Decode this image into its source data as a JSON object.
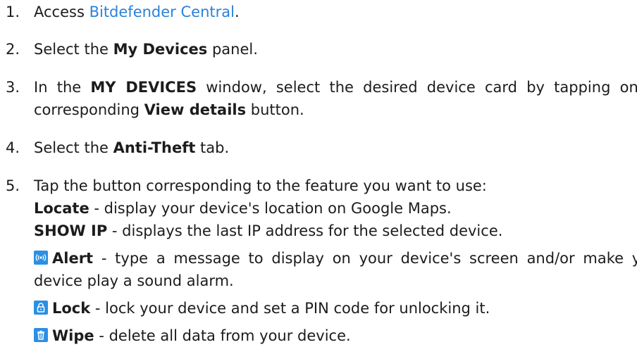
{
  "steps": [
    {
      "num": "1.",
      "text_before": "Access ",
      "link": "Bitdefender Central",
      "text_after": "."
    },
    {
      "num": "2.",
      "text_before": "Select the ",
      "bold": "My Devices",
      "text_after": " panel."
    },
    {
      "num": "3.",
      "text_before": "In the ",
      "bold1": "MY DEVICES",
      "text_mid": " window, select the desired device card by tapping on its corresponding ",
      "bold2": "View details",
      "text_after": " button."
    },
    {
      "num": "4.",
      "text_before": "Select the ",
      "bold": "Anti-Theft",
      "text_after": " tab."
    },
    {
      "num": "5.",
      "text": "Tap the button corresponding to the feature you want to use:"
    }
  ],
  "features": [
    {
      "name": "Locate",
      "desc": " - display your device's location on Google Maps."
    },
    {
      "name": "SHOW IP",
      "desc": " - displays the last IP address for the selected device."
    },
    {
      "icon": "alert-icon",
      "name": "Alert",
      "desc": " - type a message to display on your device's screen and/or make your device play a sound alarm."
    },
    {
      "icon": "lock-icon",
      "name": "Lock",
      "desc": " - lock your device and set a PIN code for unlocking it."
    },
    {
      "icon": "wipe-icon",
      "name": "Wipe",
      "desc": " - delete all data from your device."
    }
  ],
  "colors": {
    "link": "#2a82db",
    "icon_bg": "#2b8fe3",
    "text": "#1c1c1c"
  }
}
